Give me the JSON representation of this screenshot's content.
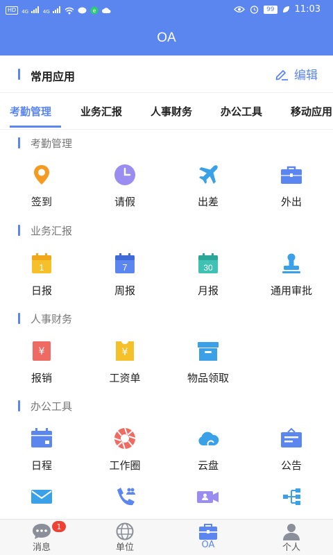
{
  "status_bar": {
    "left_badge": "HD",
    "signal_1": "4G",
    "signal_2": "4G",
    "battery": "99",
    "time": "11:03"
  },
  "header": {
    "title": "OA"
  },
  "common_apps": {
    "title": "常用应用",
    "edit_label": "编辑"
  },
  "tabs": [
    {
      "label": "考勤管理",
      "active": true
    },
    {
      "label": "业务汇报",
      "active": false
    },
    {
      "label": "人事财务",
      "active": false
    },
    {
      "label": "办公工具",
      "active": false
    },
    {
      "label": "移动应用",
      "active": false
    }
  ],
  "groups": [
    {
      "title": "考勤管理",
      "items": [
        {
          "label": "签到",
          "icon": "location-pin-icon"
        },
        {
          "label": "请假",
          "icon": "clock-icon"
        },
        {
          "label": "出差",
          "icon": "airplane-icon"
        },
        {
          "label": "外出",
          "icon": "briefcase-icon"
        }
      ]
    },
    {
      "title": "业务汇报",
      "items": [
        {
          "label": "日报",
          "icon": "calendar-1-icon",
          "day": "1"
        },
        {
          "label": "周报",
          "icon": "calendar-7-icon",
          "day": "7"
        },
        {
          "label": "月报",
          "icon": "calendar-30-icon",
          "day": "30"
        },
        {
          "label": "通用审批",
          "icon": "stamp-icon"
        }
      ]
    },
    {
      "title": "人事财务",
      "items": [
        {
          "label": "报销",
          "icon": "yuan-receipt-icon",
          "symbol": "¥"
        },
        {
          "label": "工资单",
          "icon": "salary-slip-icon",
          "symbol": "¥"
        },
        {
          "label": "物品领取",
          "icon": "box-icon"
        }
      ]
    },
    {
      "title": "办公工具",
      "items": [
        {
          "label": "日程",
          "icon": "schedule-icon"
        },
        {
          "label": "工作圈",
          "icon": "aperture-icon"
        },
        {
          "label": "云盘",
          "icon": "cloud-icon"
        },
        {
          "label": "公告",
          "icon": "announcement-icon"
        }
      ]
    }
  ],
  "partial_row_icons": [
    "mail-icon",
    "phone-contacts-icon",
    "video-meeting-icon",
    "org-tree-icon"
  ],
  "bottom_nav": [
    {
      "label": "消息",
      "icon": "message-icon",
      "badge": "1",
      "active": false
    },
    {
      "label": "单位",
      "icon": "globe-icon",
      "active": false
    },
    {
      "label": "OA",
      "icon": "oa-briefcase-icon",
      "active": true
    },
    {
      "label": "个人",
      "icon": "person-icon",
      "active": false
    }
  ],
  "colors": {
    "primary": "#5b86f0",
    "orange": "#f59a23",
    "purple": "#9b8cf0",
    "yellow": "#f5c02a",
    "teal": "#3fc1b3",
    "red": "#ee6a62",
    "badge_red": "#f04134"
  }
}
